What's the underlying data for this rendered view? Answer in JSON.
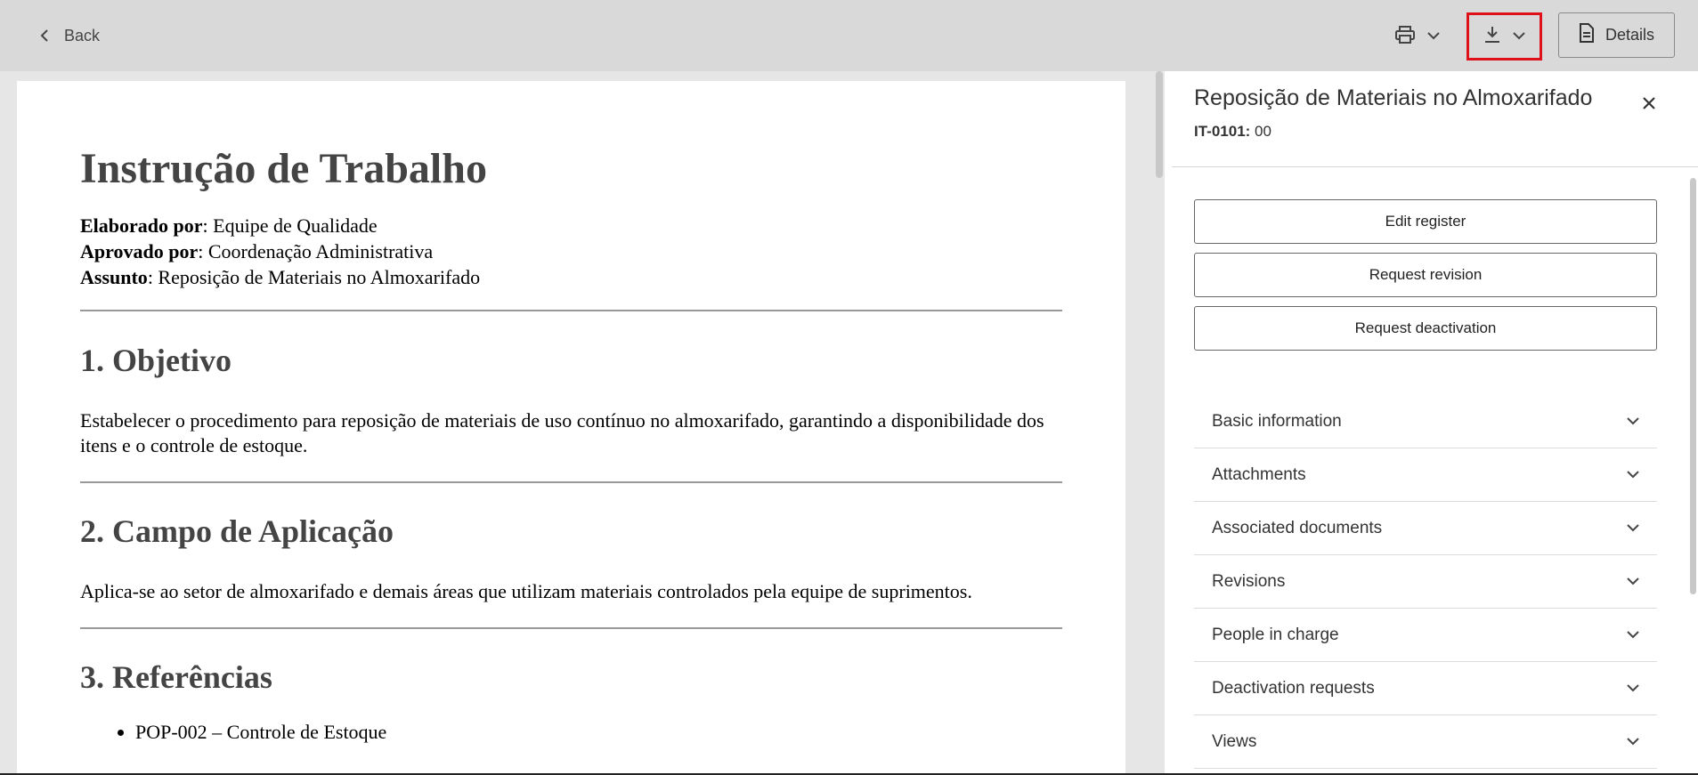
{
  "toolbar": {
    "back_label": "Back",
    "details_label": "Details"
  },
  "document": {
    "title": "Instrução de Trabalho",
    "meta": [
      {
        "key": "Elaborado por",
        "value": ": Equipe de Qualidade"
      },
      {
        "key": "Aprovado por",
        "value": ": Coordenação Administrativa"
      },
      {
        "key": "Assunto",
        "value": ": Reposição de Materiais no Almoxarifado"
      }
    ],
    "sections": [
      {
        "heading": "1. Objetivo",
        "text": "Estabelecer o procedimento para reposição de materiais de uso contínuo no almoxarifado, garantindo a disponibilidade dos itens e o controle de estoque."
      },
      {
        "heading": "2. Campo de Aplicação",
        "text": "Aplica-se ao setor de almoxarifado e demais áreas que utilizam materiais controlados pela equipe de suprimentos."
      },
      {
        "heading": "3. Referências",
        "bullets": [
          "POP-002 – Controle de Estoque"
        ]
      }
    ]
  },
  "panel": {
    "title": "Reposição de Materiais no Almoxarifado",
    "code_label": "IT-0101:",
    "code_value": " 00",
    "buttons": [
      "Edit register",
      "Request revision",
      "Request deactivation"
    ],
    "sections": [
      "Basic information",
      "Attachments",
      "Associated documents",
      "Revisions",
      "People in charge",
      "Deactivation requests",
      "Views"
    ]
  },
  "icons": {
    "back": "chevron-left-icon",
    "print": "printer-icon",
    "download": "download-icon",
    "dropdown": "chevron-down-icon",
    "details": "document-icon",
    "close": "close-icon"
  },
  "colors": {
    "highlight": "#e0101a",
    "toolbar_bg": "#d9d9d9",
    "page_bg": "#e6e6e6"
  }
}
